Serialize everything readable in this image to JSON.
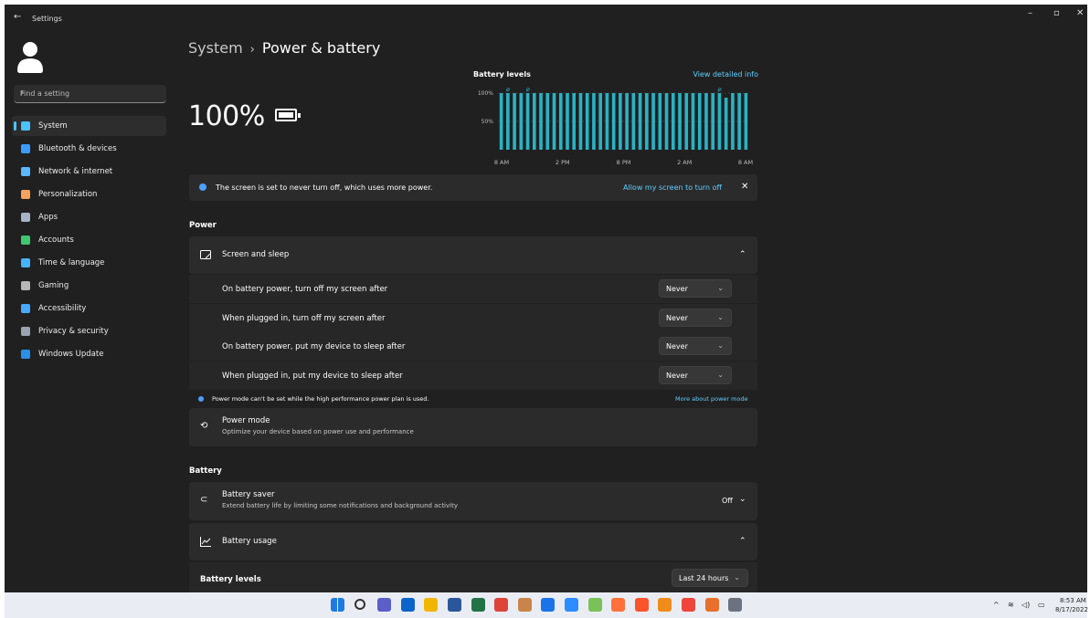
{
  "window": {
    "title": "Settings",
    "back_icon": "back-arrow-icon",
    "minimize": "–",
    "maximize": "▫",
    "close": "✕"
  },
  "sidebar": {
    "search_placeholder": "Find a setting",
    "items": [
      {
        "label": "System",
        "icon": "system-icon",
        "color": "#4cc2ff",
        "selected": true
      },
      {
        "label": "Bluetooth & devices",
        "icon": "bluetooth-icon",
        "color": "#3b9cff"
      },
      {
        "label": "Network & internet",
        "icon": "wifi-icon",
        "color": "#5bb8ff"
      },
      {
        "label": "Personalization",
        "icon": "brush-icon",
        "color": "#f4a25c"
      },
      {
        "label": "Apps",
        "icon": "apps-icon",
        "color": "#a6b4c8"
      },
      {
        "label": "Accounts",
        "icon": "person-icon",
        "color": "#3fc770"
      },
      {
        "label": "Time & language",
        "icon": "globe-clock-icon",
        "color": "#45b4ff"
      },
      {
        "label": "Gaming",
        "icon": "gamepad-icon",
        "color": "#b7b7b7"
      },
      {
        "label": "Accessibility",
        "icon": "accessibility-icon",
        "color": "#48a8ff"
      },
      {
        "label": "Privacy & security",
        "icon": "shield-icon",
        "color": "#9aa3b0"
      },
      {
        "label": "Windows Update",
        "icon": "update-icon",
        "color": "#2a8fe8"
      }
    ]
  },
  "header": {
    "crumb_parent": "System",
    "crumb_sep": "›",
    "crumb_current": "Power & battery"
  },
  "battery_summary": {
    "percent": "100%"
  },
  "chart_data": {
    "type": "bar",
    "title": "Battery levels",
    "link": "View detailed info",
    "y_ticks": [
      "100%",
      "50%"
    ],
    "x_ticks": [
      "8 AM",
      "2 PM",
      "8 PM",
      "2 AM",
      "8 AM"
    ],
    "values": [
      100,
      100,
      100,
      100,
      100,
      100,
      100,
      100,
      100,
      100,
      100,
      100,
      100,
      100,
      100,
      100,
      100,
      100,
      100,
      100,
      100,
      100,
      100,
      100,
      100,
      100,
      100,
      100,
      100,
      100,
      100,
      100,
      100,
      100,
      92,
      100,
      100,
      100
    ],
    "charging_markers_at": [
      1,
      4,
      33
    ],
    "ylim": [
      0,
      100
    ],
    "bar_color": "#2ab2c4"
  },
  "notice": {
    "text": "The screen is set to never turn off, which uses more power.",
    "action": "Allow my screen to turn off",
    "close": "✕"
  },
  "power_section": {
    "title": "Power",
    "screen_sleep": {
      "label": "Screen and sleep",
      "chevron": "⌃",
      "rows": [
        {
          "label": "On battery power, turn off my screen after",
          "value": "Never"
        },
        {
          "label": "When plugged in, turn off my screen after",
          "value": "Never"
        },
        {
          "label": "On battery power, put my device to sleep after",
          "value": "Never"
        },
        {
          "label": "When plugged in, put my device to sleep after",
          "value": "Never"
        }
      ]
    },
    "power_mode_notice": "Power mode can't be set while the high performance power plan is used.",
    "power_mode_link": "More about power mode",
    "power_mode": {
      "label": "Power mode",
      "desc": "Optimize your device based on power use and performance"
    }
  },
  "battery_section": {
    "title": "Battery",
    "saver": {
      "label": "Battery saver",
      "desc": "Extend battery life by limiting some notifications and background activity",
      "state": "Off"
    },
    "usage": {
      "label": "Battery usage",
      "chevron": "⌃"
    },
    "levels_label": "Battery levels",
    "range": "Last 24 hours"
  },
  "taskbar": {
    "icons": [
      {
        "name": "start-icon",
        "color": "#1e7ae0"
      },
      {
        "name": "search-icon",
        "color": "#333333"
      },
      {
        "name": "teams-icon",
        "color": "#5b5fc7"
      },
      {
        "name": "outlook-icon",
        "color": "#0a64c9"
      },
      {
        "name": "file-explorer-icon",
        "color": "#f2b600"
      },
      {
        "name": "word-icon",
        "color": "#2b579a"
      },
      {
        "name": "excel-icon",
        "color": "#217346"
      },
      {
        "name": "chrome-icon",
        "color": "#db4437"
      },
      {
        "name": "app-icon",
        "color": "#c9844a"
      },
      {
        "name": "remote-icon",
        "color": "#1a73e8"
      },
      {
        "name": "chat-icon",
        "color": "#2d8cff"
      },
      {
        "name": "android-icon",
        "color": "#78c257"
      },
      {
        "name": "firefox-icon",
        "color": "#ff7139"
      },
      {
        "name": "brave-icon",
        "color": "#fb542b"
      },
      {
        "name": "vlc-icon",
        "color": "#f08c1a"
      },
      {
        "name": "anydesk-icon",
        "color": "#ef443b"
      },
      {
        "name": "paint-icon",
        "color": "#e86f2c"
      },
      {
        "name": "settings-icon",
        "color": "#6b7280"
      }
    ],
    "time": "8:53 AM",
    "date": "8/17/2022"
  }
}
